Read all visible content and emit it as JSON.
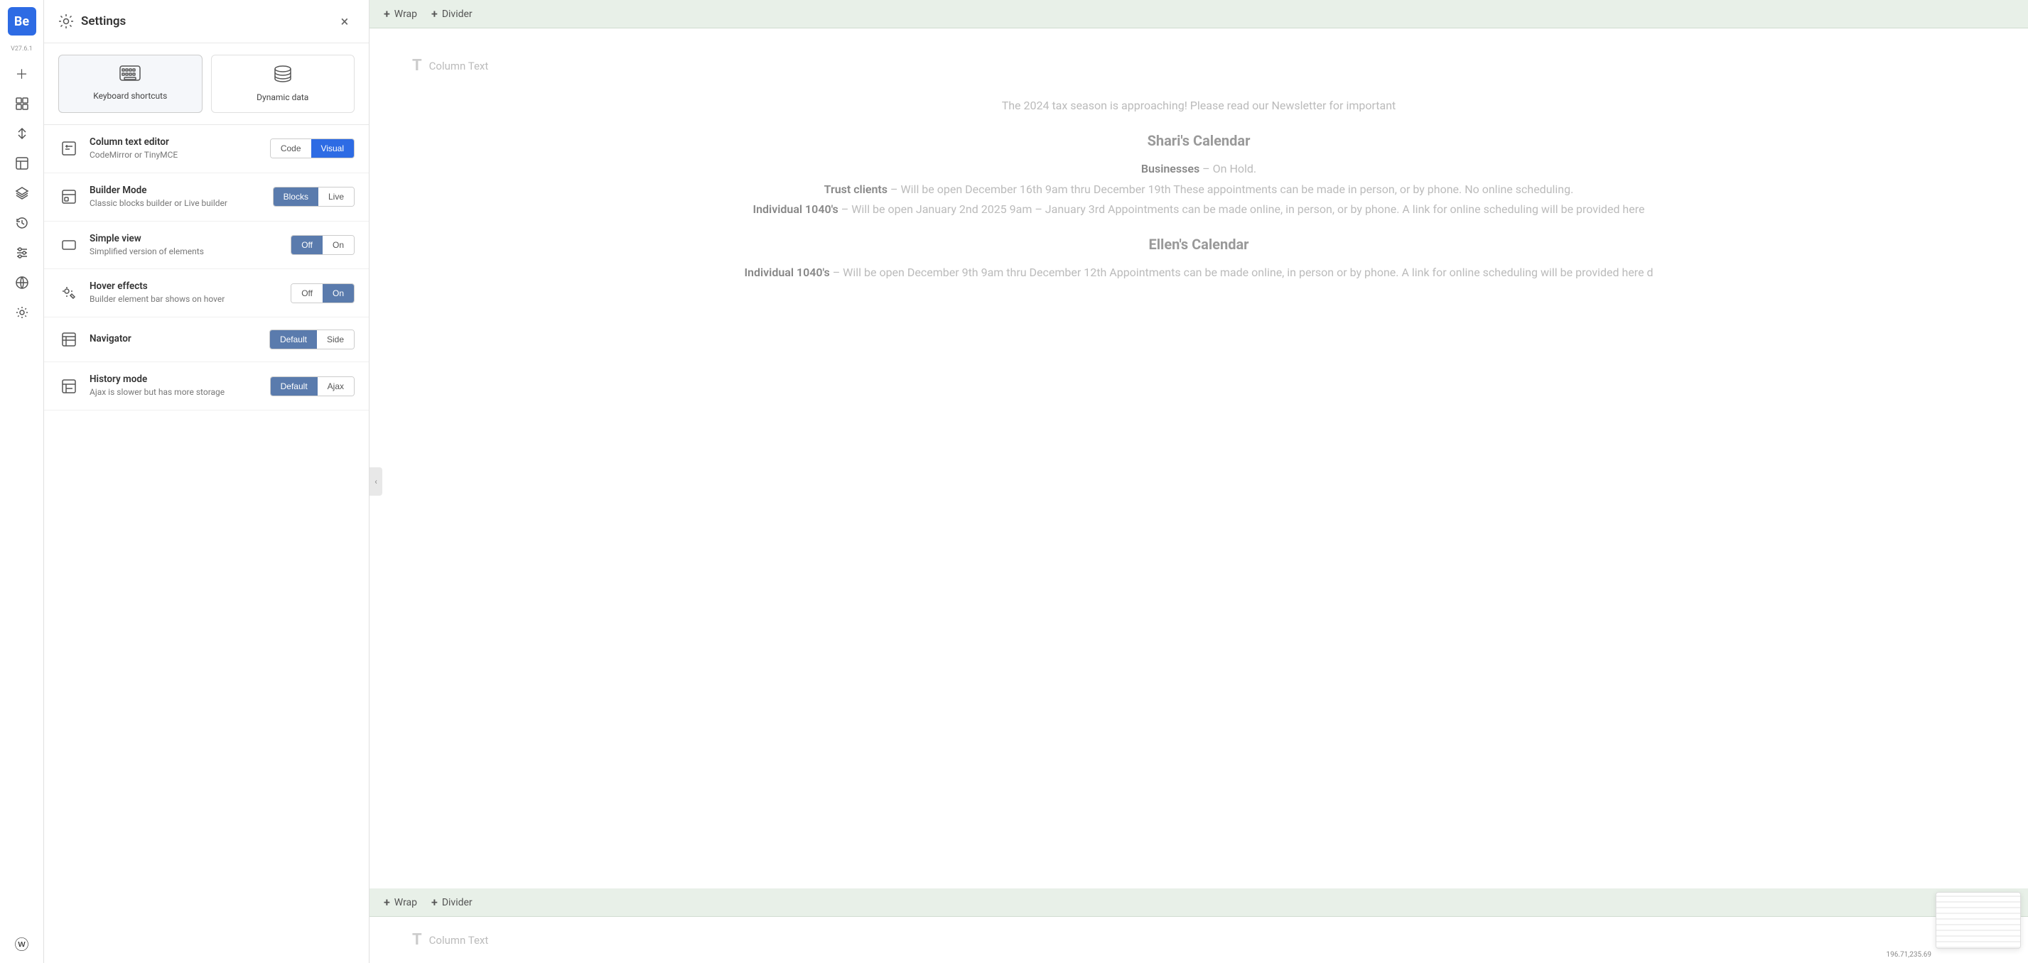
{
  "brand": {
    "logo_letter": "Be",
    "version": "V27.6.1"
  },
  "sidebar_icons": [
    {
      "name": "add-icon",
      "glyph": "＋"
    },
    {
      "name": "grid-icon",
      "glyph": "⊞"
    },
    {
      "name": "sort-icon",
      "glyph": "⇅"
    },
    {
      "name": "layout-icon",
      "glyph": "▦"
    },
    {
      "name": "layers-icon",
      "glyph": "☰"
    },
    {
      "name": "history-icon",
      "glyph": "↺"
    },
    {
      "name": "sliders-icon",
      "glyph": "⚙"
    },
    {
      "name": "globe-icon",
      "glyph": "🌐"
    },
    {
      "name": "settings-icon",
      "glyph": "⚙"
    },
    {
      "name": "wordpress-icon",
      "glyph": "ⓦ"
    }
  ],
  "settings": {
    "title": "Settings",
    "close_label": "×",
    "tabs": [
      {
        "id": "keyboard-shortcuts",
        "label": "Keyboard shortcuts",
        "icon": "⌨"
      },
      {
        "id": "dynamic-data",
        "label": "Dynamic data",
        "icon": "🗄"
      }
    ],
    "rows": [
      {
        "id": "column-text-editor",
        "icon": "T",
        "title": "Column text editor",
        "desc": "CodeMirror or TinyMCE",
        "controls": [
          {
            "label": "Code",
            "active": false
          },
          {
            "label": "Visual",
            "active": true
          }
        ]
      },
      {
        "id": "builder-mode",
        "icon": "⊡",
        "title": "Builder Mode",
        "desc": "Classic blocks builder or Live builder",
        "controls": [
          {
            "label": "Blocks",
            "active": true
          },
          {
            "label": "Live",
            "active": false
          }
        ]
      },
      {
        "id": "simple-view",
        "icon": "▭",
        "title": "Simple view",
        "desc": "Simplified version of elements",
        "controls": [
          {
            "label": "Off",
            "active": true
          },
          {
            "label": "On",
            "active": false
          }
        ]
      },
      {
        "id": "hover-effects",
        "icon": "✦",
        "title": "Hover effects",
        "desc": "Builder element bar shows on hover",
        "controls": [
          {
            "label": "Off",
            "active": false
          },
          {
            "label": "On",
            "active": true
          }
        ]
      },
      {
        "id": "navigator",
        "icon": "⊞",
        "title": "Navigator",
        "desc": "",
        "controls": [
          {
            "label": "Default",
            "active": true
          },
          {
            "label": "Side",
            "active": false
          }
        ]
      },
      {
        "id": "history-mode",
        "icon": "⊡",
        "title": "History mode",
        "desc": "Ajax is slower but has more storage",
        "controls": [
          {
            "label": "Default",
            "active": true
          },
          {
            "label": "Ajax",
            "active": false
          }
        ]
      }
    ]
  },
  "main": {
    "wrap_button": "+ Wrap",
    "divider_button": "+ Divider",
    "column_text_label": "Column Text",
    "content": {
      "intro": "The 2024 tax season is approaching! Please read our Newsletter for important",
      "shari_calendar": "Shari's Calendar",
      "businesses_label": "Businesses",
      "businesses_status": "– On Hold.",
      "trust_clients_label": "Trust clients",
      "trust_clients_text": "– Will be open December 16th 9am thru December 19th These appointments can be made in person, or by phone. No online scheduling.",
      "individual_1040s_label": "Individual 1040's",
      "individual_1040s_text": "– Will be open January 2nd 2025 9am – January 3rd Appointments can be made online, in person, or by phone. A link for online scheduling will be provided here",
      "ellen_calendar": "Ellen's Calendar",
      "ellen_1040s_label": "Individual 1040's",
      "ellen_1040s_text": "– Will be open December 9th 9am thru December 12th Appointments can be made online, in person or by phone. A link for online scheduling will be provided here d",
      "column_text_bottom": "Column Text",
      "coordinates": "196.71,235.69"
    }
  }
}
